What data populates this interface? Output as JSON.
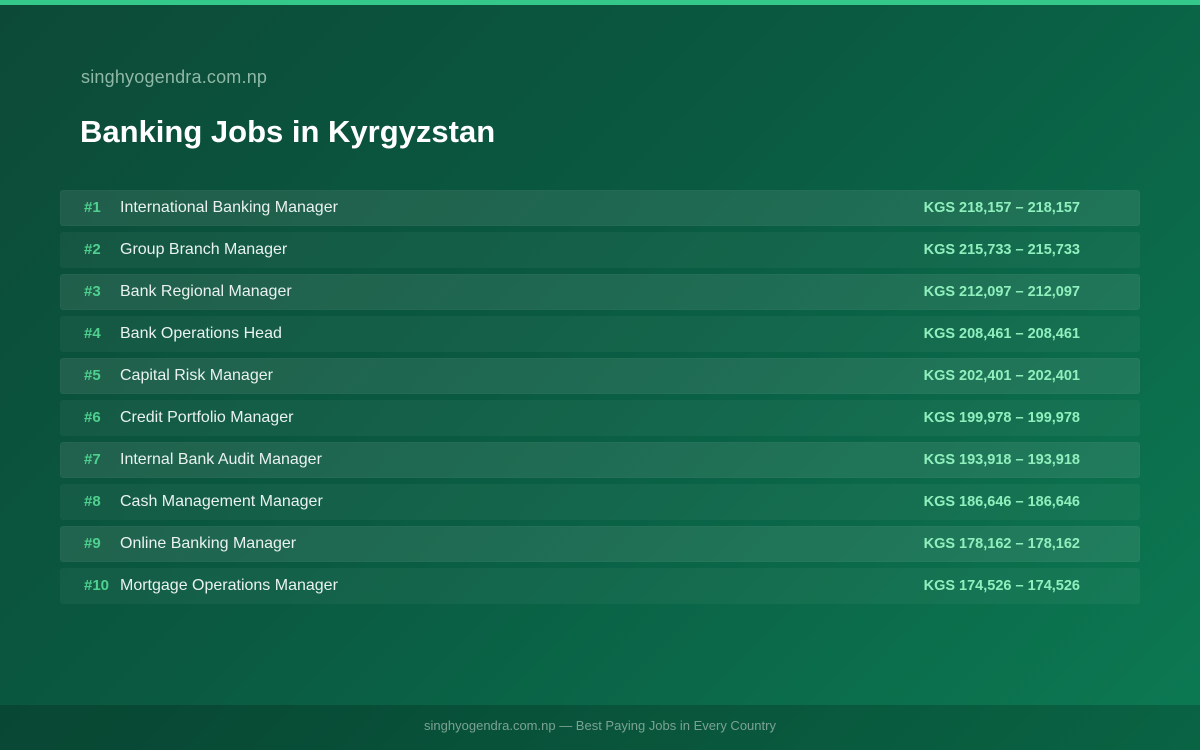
{
  "site_name": "singhyogendra.com.np",
  "title": "Banking Jobs in Kyrgyzstan",
  "colors": {
    "accent": "#34c98a",
    "rank": "#4fd08f",
    "salary": "#8ff0bd",
    "background": "#0a5a41"
  },
  "jobs": [
    {
      "rank": "#1",
      "title": "International Banking Manager",
      "salary": "KGS 218,157 – 218,157"
    },
    {
      "rank": "#2",
      "title": "Group Branch Manager",
      "salary": "KGS 215,733 – 215,733"
    },
    {
      "rank": "#3",
      "title": "Bank Regional Manager",
      "salary": "KGS 212,097 – 212,097"
    },
    {
      "rank": "#4",
      "title": "Bank Operations Head",
      "salary": "KGS 208,461 – 208,461"
    },
    {
      "rank": "#5",
      "title": "Capital Risk Manager",
      "salary": "KGS 202,401 – 202,401"
    },
    {
      "rank": "#6",
      "title": "Credit Portfolio Manager",
      "salary": "KGS 199,978 – 199,978"
    },
    {
      "rank": "#7",
      "title": "Internal Bank Audit Manager",
      "salary": "KGS 193,918 – 193,918"
    },
    {
      "rank": "#8",
      "title": "Cash Management Manager",
      "salary": "KGS 186,646 – 186,646"
    },
    {
      "rank": "#9",
      "title": "Online Banking Manager",
      "salary": "KGS 178,162 – 178,162"
    },
    {
      "rank": "#10",
      "title": "Mortgage Operations Manager",
      "salary": "KGS 174,526 – 174,526"
    }
  ],
  "footer": {
    "text": "singhyogendra.com.np — Best Paying Jobs in Every Country"
  }
}
